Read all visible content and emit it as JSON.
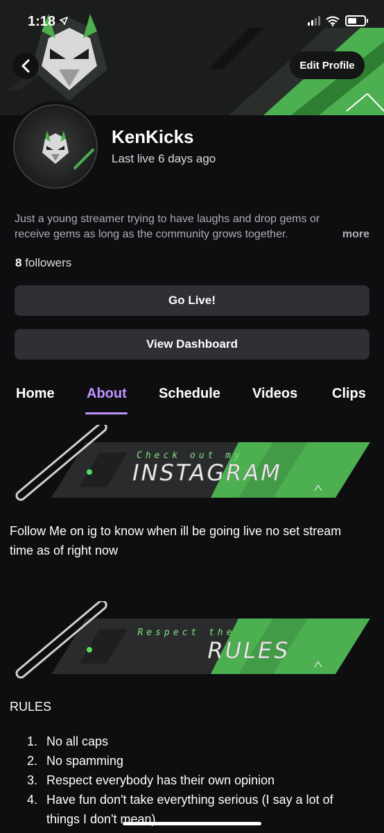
{
  "status_bar": {
    "time": "1:18"
  },
  "header": {
    "edit_profile_label": "Edit Profile"
  },
  "profile": {
    "channel_name": "KenKicks",
    "last_live": "Last live 6 days ago",
    "bio_line1": "Just a young streamer trying to have laughs and drop gems or",
    "bio_line2": "receive gems as long as the community grows together.",
    "more_label": "more",
    "followers_count": "8",
    "followers_label": "followers"
  },
  "actions": {
    "go_live": "Go Live!",
    "view_dashboard": "View Dashboard"
  },
  "tabs": [
    {
      "label": "Home"
    },
    {
      "label": "About",
      "active": true
    },
    {
      "label": "Schedule"
    },
    {
      "label": "Videos"
    },
    {
      "label": "Clips"
    }
  ],
  "about": {
    "instagram_panel": {
      "small_text": "Check out my",
      "big_text": "INSTAGRAM"
    },
    "instagram_text_line1": "Follow Me on ig to know when ill be going live no set stream",
    "instagram_text_line2": "time as of right now",
    "rules_panel": {
      "small_text": "Respect the",
      "big_text": "RULES"
    },
    "rules_title": "RULES",
    "rules": [
      {
        "num": "1.",
        "text": "No all caps"
      },
      {
        "num": "2.",
        "text": "No spamming"
      },
      {
        "num": "3.",
        "text": "Respect everybody has their own opinion"
      },
      {
        "num": "4.",
        "text": "Have fun don't take everything serious (I say a lot of",
        "text2": "things I don't mean)"
      }
    ]
  },
  "colors": {
    "accent": "#bf94ff",
    "brand_green": "#4caf50",
    "background": "#0e0e10",
    "button": "#2f2f35"
  }
}
